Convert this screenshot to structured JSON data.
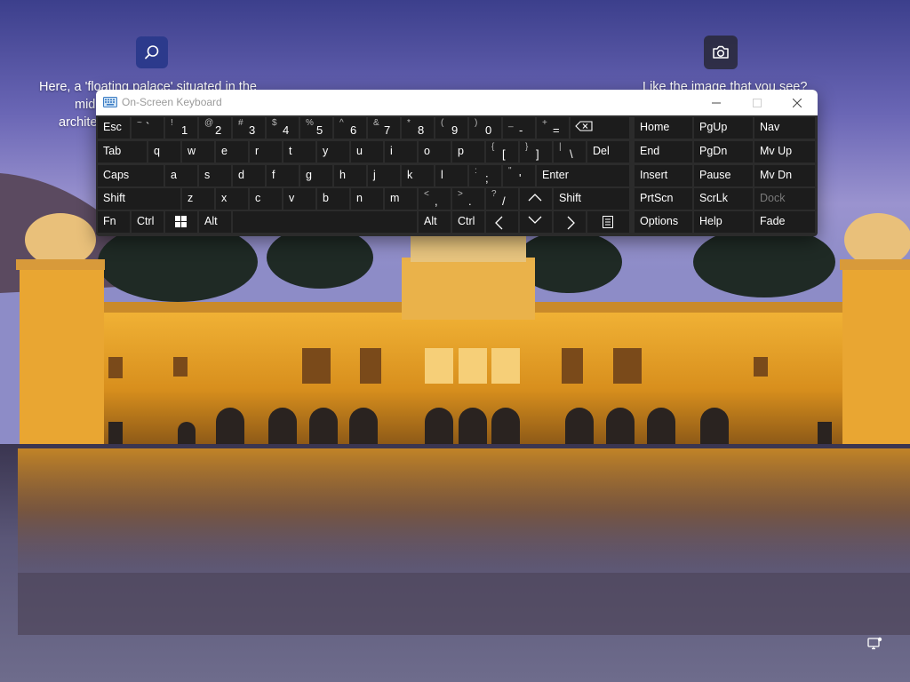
{
  "lock_screen": {
    "spotlight_lines": [
      "Here, a 'floating palace' situated in the",
      "mid",
      "archite"
    ],
    "like_text": "Like the image that you see?",
    "icons": {
      "search": "search-icon",
      "camera": "camera-icon",
      "status": "network-status-icon"
    }
  },
  "osk": {
    "title": "On-Screen Keyboard",
    "window_controls": [
      "minimize-icon",
      "maximize-icon",
      "close-icon"
    ],
    "keys": {
      "esc": "Esc",
      "tilde_shift": "~",
      "tilde": "`",
      "n1_shift": "!",
      "n1": "1",
      "n2_shift": "@",
      "n2": "2",
      "n3_shift": "#",
      "n3": "3",
      "n4_shift": "$",
      "n4": "4",
      "n5_shift": "%",
      "n5": "5",
      "n6_shift": "^",
      "n6": "6",
      "n7_shift": "&",
      "n7": "7",
      "n8_shift": "*",
      "n8": "8",
      "n9_shift": "(",
      "n9": "9",
      "n0_shift": ")",
      "n0": "0",
      "minus_shift": "_",
      "minus": "-",
      "equal_shift": "+",
      "equal": "=",
      "tab": "Tab",
      "q": "q",
      "w": "w",
      "e": "e",
      "r": "r",
      "t": "t",
      "y": "y",
      "u": "u",
      "i": "i",
      "o": "o",
      "p": "p",
      "lbracket_shift": "{",
      "lbracket": "[",
      "rbracket_shift": "}",
      "rbracket": "]",
      "backslash_shift": "|",
      "backslash": "\\",
      "del": "Del",
      "caps": "Caps",
      "a": "a",
      "s": "s",
      "d": "d",
      "f": "f",
      "g": "g",
      "h": "h",
      "j": "j",
      "k": "k",
      "l": "l",
      "semicolon_shift": ":",
      "semicolon": ";",
      "quote_shift": "\"",
      "quote": "'",
      "enter": "Enter",
      "shift_left": "Shift",
      "z": "z",
      "x": "x",
      "c": "c",
      "v": "v",
      "b": "b",
      "n": "n",
      "m": "m",
      "comma_shift": "<",
      "comma": ",",
      "period_shift": ">",
      "period": ".",
      "slash_shift": "?",
      "slash": "/",
      "shift_right": "Shift",
      "fn": "Fn",
      "ctrl_left": "Ctrl",
      "alt_left": "Alt",
      "alt_right": "Alt",
      "ctrl_right": "Ctrl",
      "home": "Home",
      "pgup": "PgUp",
      "nav": "Nav",
      "end": "End",
      "pgdn": "PgDn",
      "mvup": "Mv Up",
      "insert": "Insert",
      "pause": "Pause",
      "mvdn": "Mv Dn",
      "prtscn": "PrtScn",
      "scrlk": "ScrLk",
      "dock": "Dock",
      "options": "Options",
      "help": "Help",
      "fade": "Fade"
    }
  }
}
